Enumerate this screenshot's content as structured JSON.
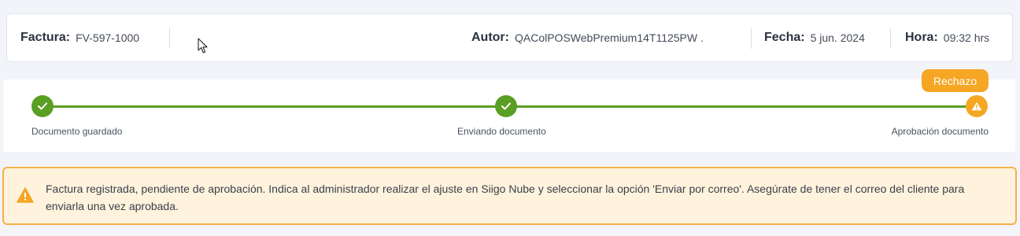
{
  "invoice": {
    "factura_label": "Factura:",
    "factura_value": "FV-597-1000",
    "autor_label": "Autor:",
    "autor_value": "QAColPOSWebPremium14T1125PW .",
    "fecha_label": "Fecha:",
    "fecha_value": "5 jun. 2024",
    "hora_label": "Hora:",
    "hora_value": "09:32 hrs"
  },
  "stepper": {
    "steps": [
      {
        "label": "Documento guardado",
        "status": "done",
        "icon": "check-icon"
      },
      {
        "label": "Enviando documento",
        "status": "done",
        "icon": "check-icon"
      },
      {
        "label": "Aprobación documento",
        "status": "warning",
        "icon": "warning-icon"
      }
    ],
    "badge": "Rechazo"
  },
  "alert": {
    "icon": "warning-icon",
    "message": "Factura registrada, pendiente de aprobación. Indica al administrador realizar el ajuste en Siigo Nube y seleccionar la opción 'Enviar por correo'. Asegúrate de tener el correo del cliente para enviarla una vez aprobada."
  },
  "colors": {
    "success": "#5a9e24",
    "warning": "#f5a623",
    "alert_bg": "#fff3dd",
    "alert_border": "#f5b04a"
  }
}
